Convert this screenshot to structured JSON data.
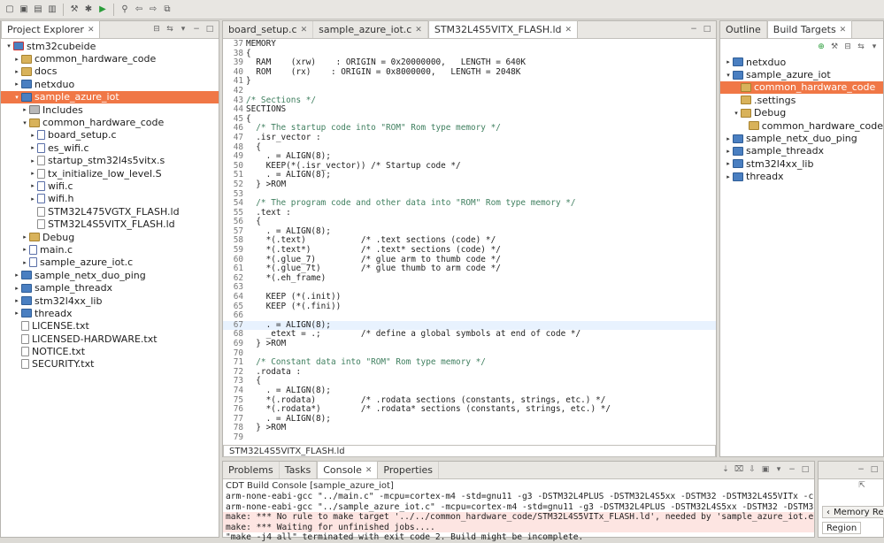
{
  "toolbar": {
    "icons": [
      "new-icon",
      "save-icon",
      "save-all-icon",
      "print-icon",
      "build-icon",
      "debug-icon",
      "run-icon",
      "search-icon",
      "back-icon",
      "forward-icon",
      "new-window-icon"
    ]
  },
  "explorer": {
    "tab_label": "Project Explorer",
    "items": [
      {
        "label": "stm32cubeide",
        "indent": 0,
        "arrow": "▾",
        "icon": "project-err",
        "selected": false
      },
      {
        "label": "common_hardware_code",
        "indent": 1,
        "arrow": "▸",
        "icon": "folder",
        "selected": false
      },
      {
        "label": "docs",
        "indent": 1,
        "arrow": "▸",
        "icon": "folder",
        "selected": false
      },
      {
        "label": "netxduo",
        "indent": 1,
        "arrow": "▸",
        "icon": "project",
        "selected": false
      },
      {
        "label": "sample_azure_iot",
        "indent": 1,
        "arrow": "▾",
        "icon": "project",
        "selected": true
      },
      {
        "label": "Includes",
        "indent": 2,
        "arrow": "▸",
        "icon": "include",
        "selected": false
      },
      {
        "label": "common_hardware_code",
        "indent": 2,
        "arrow": "▾",
        "icon": "folder",
        "selected": false
      },
      {
        "label": "board_setup.c",
        "indent": 3,
        "arrow": "▸",
        "icon": "cfile",
        "selected": false
      },
      {
        "label": "es_wifi.c",
        "indent": 3,
        "arrow": "▸",
        "icon": "cfile",
        "selected": false
      },
      {
        "label": "startup_stm32l4s5vitx.s",
        "indent": 3,
        "arrow": "▸",
        "icon": "file",
        "selected": false
      },
      {
        "label": "tx_initialize_low_level.S",
        "indent": 3,
        "arrow": "▸",
        "icon": "file",
        "selected": false
      },
      {
        "label": "wifi.c",
        "indent": 3,
        "arrow": "▸",
        "icon": "cfile",
        "selected": false
      },
      {
        "label": "wifi.h",
        "indent": 3,
        "arrow": "▸",
        "icon": "cfile",
        "selected": false
      },
      {
        "label": "STM32L475VGTX_FLASH.ld",
        "indent": 3,
        "arrow": "",
        "icon": "file",
        "selected": false
      },
      {
        "label": "STM32L4S5VITX_FLASH.ld",
        "indent": 3,
        "arrow": "",
        "icon": "file",
        "selected": false
      },
      {
        "label": "Debug",
        "indent": 2,
        "arrow": "▸",
        "icon": "folder",
        "selected": false
      },
      {
        "label": "main.c",
        "indent": 2,
        "arrow": "▸",
        "icon": "cfile",
        "selected": false
      },
      {
        "label": "sample_azure_iot.c",
        "indent": 2,
        "arrow": "▸",
        "icon": "cfile",
        "selected": false
      },
      {
        "label": "sample_netx_duo_ping",
        "indent": 1,
        "arrow": "▸",
        "icon": "project",
        "selected": false
      },
      {
        "label": "sample_threadx",
        "indent": 1,
        "arrow": "▸",
        "icon": "project",
        "selected": false
      },
      {
        "label": "stm32l4xx_lib",
        "indent": 1,
        "arrow": "▸",
        "icon": "project",
        "selected": false
      },
      {
        "label": "threadx",
        "indent": 1,
        "arrow": "▸",
        "icon": "project",
        "selected": false
      },
      {
        "label": "LICENSE.txt",
        "indent": 1,
        "arrow": "",
        "icon": "file",
        "selected": false
      },
      {
        "label": "LICENSED-HARDWARE.txt",
        "indent": 1,
        "arrow": "",
        "icon": "file",
        "selected": false
      },
      {
        "label": "NOTICE.txt",
        "indent": 1,
        "arrow": "",
        "icon": "file",
        "selected": false
      },
      {
        "label": "SECURITY.txt",
        "indent": 1,
        "arrow": "",
        "icon": "file",
        "selected": false
      }
    ]
  },
  "editor": {
    "tabs": [
      {
        "label": "board_setup.c",
        "active": false
      },
      {
        "label": "sample_azure_iot.c",
        "active": false
      },
      {
        "label": "STM32L4S5VITX_FLASH.ld",
        "active": true
      }
    ],
    "bottom_tab": "STM32L4S5VITX_FLASH.ld",
    "lines": [
      {
        "n": "37",
        "t": "MEMORY",
        "c": false
      },
      {
        "n": "38",
        "t": "{",
        "c": false
      },
      {
        "n": "39",
        "t": "  RAM    (xrw)    : ORIGIN = 0x20000000,   LENGTH = 640K",
        "c": false
      },
      {
        "n": "40",
        "t": "  ROM    (rx)    : ORIGIN = 0x8000000,   LENGTH = 2048K",
        "c": false
      },
      {
        "n": "41",
        "t": "}",
        "c": false
      },
      {
        "n": "42",
        "t": "",
        "c": false
      },
      {
        "n": "43",
        "t": "/* Sections */",
        "c": true
      },
      {
        "n": "44",
        "t": "SECTIONS",
        "c": false
      },
      {
        "n": "45",
        "t": "{",
        "c": false
      },
      {
        "n": "46",
        "t": "  /* The startup code into \"ROM\" Rom type memory */",
        "c": true
      },
      {
        "n": "47",
        "t": "  .isr_vector :",
        "c": false
      },
      {
        "n": "48",
        "t": "  {",
        "c": false
      },
      {
        "n": "49",
        "t": "    . = ALIGN(8);",
        "c": false
      },
      {
        "n": "50",
        "t": "    KEEP(*(.isr_vector)) /* Startup code */",
        "c": false
      },
      {
        "n": "51",
        "t": "    . = ALIGN(8);",
        "c": false
      },
      {
        "n": "52",
        "t": "  } >ROM",
        "c": false
      },
      {
        "n": "53",
        "t": "",
        "c": false
      },
      {
        "n": "54",
        "t": "  /* The program code and other data into \"ROM\" Rom type memory */",
        "c": true
      },
      {
        "n": "55",
        "t": "  .text :",
        "c": false
      },
      {
        "n": "56",
        "t": "  {",
        "c": false
      },
      {
        "n": "57",
        "t": "    . = ALIGN(8);",
        "c": false
      },
      {
        "n": "58",
        "t": "    *(.text)           /* .text sections (code) */",
        "c": false
      },
      {
        "n": "59",
        "t": "    *(.text*)          /* .text* sections (code) */",
        "c": false
      },
      {
        "n": "60",
        "t": "    *(.glue_7)         /* glue arm to thumb code */",
        "c": false
      },
      {
        "n": "61",
        "t": "    *(.glue_7t)        /* glue thumb to arm code */",
        "c": false
      },
      {
        "n": "62",
        "t": "    *(.eh_frame)",
        "c": false
      },
      {
        "n": "63",
        "t": "",
        "c": false
      },
      {
        "n": "64",
        "t": "    KEEP (*(.init))",
        "c": false
      },
      {
        "n": "65",
        "t": "    KEEP (*(.fini))",
        "c": false
      },
      {
        "n": "66",
        "t": "",
        "c": false
      },
      {
        "n": "67",
        "t": "    . = ALIGN(8);",
        "c": false,
        "hl": true
      },
      {
        "n": "68",
        "t": "    _etext = .;        /* define a global symbols at end of code */",
        "c": false
      },
      {
        "n": "69",
        "t": "  } >ROM",
        "c": false
      },
      {
        "n": "70",
        "t": "",
        "c": false
      },
      {
        "n": "71",
        "t": "  /* Constant data into \"ROM\" Rom type memory */",
        "c": true
      },
      {
        "n": "72",
        "t": "  .rodata :",
        "c": false
      },
      {
        "n": "73",
        "t": "  {",
        "c": false
      },
      {
        "n": "74",
        "t": "    . = ALIGN(8);",
        "c": false
      },
      {
        "n": "75",
        "t": "    *(.rodata)         /* .rodata sections (constants, strings, etc.) */",
        "c": false
      },
      {
        "n": "76",
        "t": "    *(.rodata*)        /* .rodata* sections (constants, strings, etc.) */",
        "c": false
      },
      {
        "n": "77",
        "t": "    . = ALIGN(8);",
        "c": false
      },
      {
        "n": "78",
        "t": "  } >ROM",
        "c": false
      },
      {
        "n": "79",
        "t": "",
        "c": false
      }
    ]
  },
  "console": {
    "tabs": [
      {
        "label": "Problems",
        "active": false
      },
      {
        "label": "Tasks",
        "active": false
      },
      {
        "label": "Console",
        "active": true
      },
      {
        "label": "Properties",
        "active": false
      }
    ],
    "title": "CDT Build Console [sample_azure_iot]",
    "lines": [
      {
        "t": "arm-none-eabi-gcc \"../main.c\" -mcpu=cortex-m4 -std=gnu11 -g3 -DSTM32L4PLUS -DSTM32L4S5xx -DSTM32 -DSTM32L4S5VITx -c -I../../stm32l4xx",
        "err": false
      },
      {
        "t": "arm-none-eabi-gcc \"../sample_azure_iot.c\" -mcpu=cortex-m4 -std=gnu11 -g3 -DSTM32L4PLUS -DSTM32L4S5xx -DSTM32 -DSTM32L4S5VITx -c -I../",
        "err": false
      },
      {
        "t": "make: *** No rule to make target '../../common_hardware_code/STM32L4S5VITx_FLASH.ld', needed by 'sample_azure_iot.elf'.  Stop.",
        "err": true
      },
      {
        "t": "make: *** Waiting for unfinished jobs....",
        "err": true
      },
      {
        "t": "\"make -j4 all\" terminated with exit code 2. Build might be incomplete.",
        "err": false
      }
    ]
  },
  "outline": {
    "tabs": [
      {
        "label": "Outline",
        "active": false
      },
      {
        "label": "Build Targets",
        "active": true
      }
    ],
    "items": [
      {
        "label": "netxduo",
        "indent": 0,
        "arrow": "▸",
        "icon": "project",
        "selected": false
      },
      {
        "label": "sample_azure_iot",
        "indent": 0,
        "arrow": "▾",
        "icon": "project",
        "selected": false
      },
      {
        "label": "common_hardware_code",
        "indent": 1,
        "arrow": "",
        "icon": "folder",
        "selected": true
      },
      {
        "label": ".settings",
        "indent": 1,
        "arrow": "",
        "icon": "folder",
        "selected": false
      },
      {
        "label": "Debug",
        "indent": 1,
        "arrow": "▾",
        "icon": "folder",
        "selected": false
      },
      {
        "label": "common_hardware_code",
        "indent": 2,
        "arrow": "",
        "icon": "folder",
        "selected": false
      },
      {
        "label": "sample_netx_duo_ping",
        "indent": 0,
        "arrow": "▸",
        "icon": "project",
        "selected": false
      },
      {
        "label": "sample_threadx",
        "indent": 0,
        "arrow": "▸",
        "icon": "project",
        "selected": false
      },
      {
        "label": "stm32l4xx_lib",
        "indent": 0,
        "arrow": "▸",
        "icon": "project",
        "selected": false
      },
      {
        "label": "threadx",
        "indent": 0,
        "arrow": "▸",
        "icon": "project",
        "selected": false
      }
    ]
  },
  "side_mini": {
    "memory_label": "Memory Reg",
    "region_label": "Region"
  },
  "colors": {
    "selection": "#f07746",
    "comment": "#3f7f5f",
    "error_bg": "#fde5e2"
  }
}
